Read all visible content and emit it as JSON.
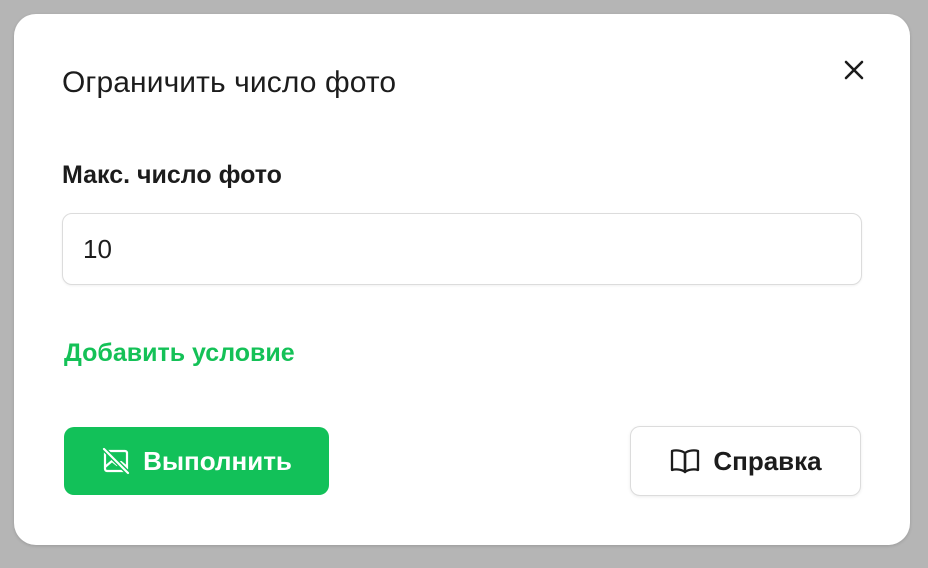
{
  "dialog": {
    "title": "Ограничить число фото",
    "close_icon": "close-icon",
    "field_label": "Макс. число фото",
    "field_value": "10",
    "add_condition_label": "Добавить условие",
    "primary_button_label": "Выполнить",
    "primary_button_icon": "no-image-icon",
    "help_button_label": "Справка",
    "help_button_icon": "book-icon"
  },
  "colors": {
    "accent": "#12c159",
    "link": "#14c157",
    "overlay": "#b5b5b5",
    "text": "#1c1c1c"
  }
}
